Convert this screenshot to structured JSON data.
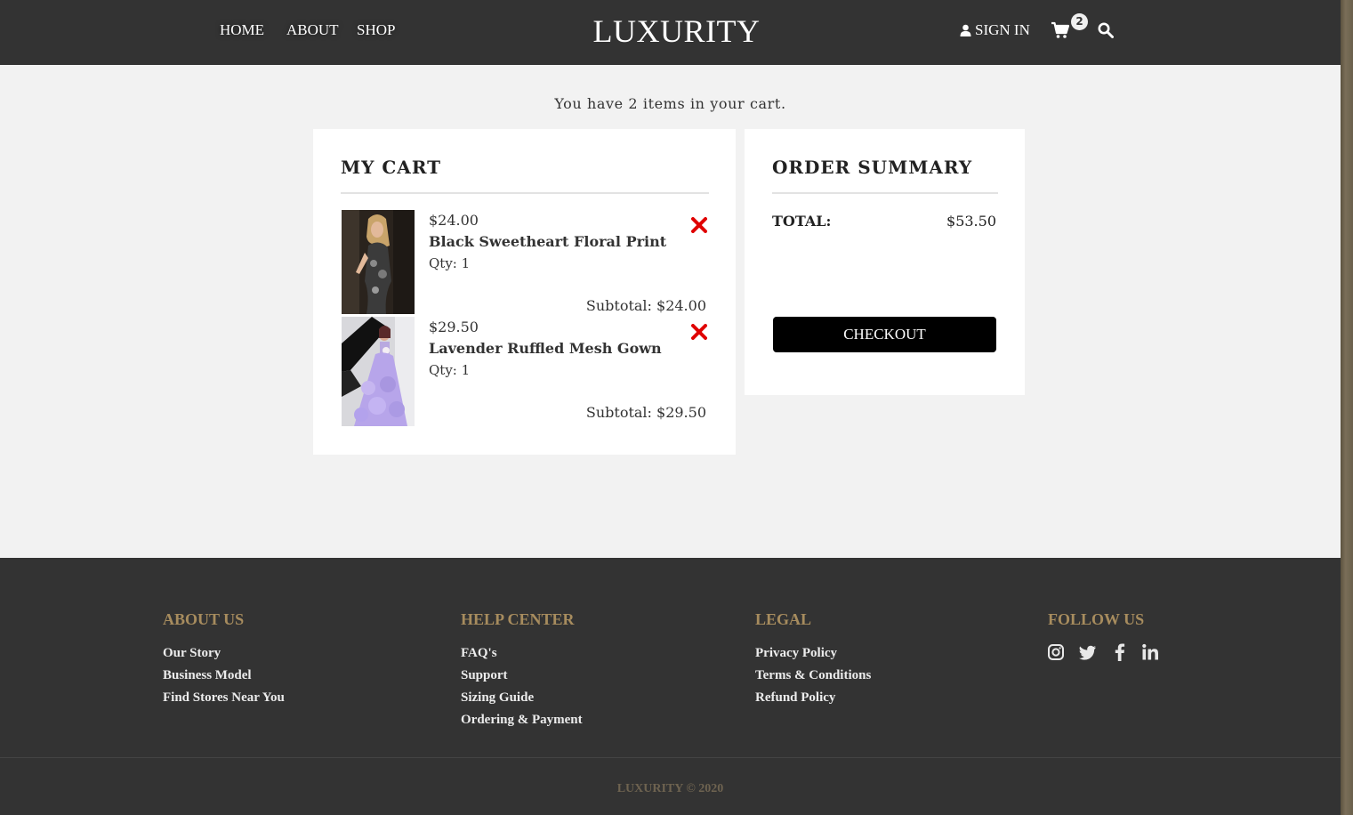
{
  "brand": "LUXURITY",
  "nav": {
    "home": "HOME",
    "about": "ABOUT",
    "shop": "SHOP",
    "sign_in": "SIGN IN",
    "cart_count": "2"
  },
  "cart_message": "You have 2 items in your cart.",
  "cart": {
    "title": "MY CART",
    "items": [
      {
        "price": "$24.00",
        "name": "Black Sweetheart Floral Print",
        "qty": "Qty: 1",
        "subtotal": "Subtotal: $24.00"
      },
      {
        "price": "$29.50",
        "name": "Lavender Ruffled Mesh Gown",
        "qty": "Qty: 1",
        "subtotal": "Subtotal: $29.50"
      }
    ]
  },
  "summary": {
    "title": "ORDER SUMMARY",
    "total_label": "TOTAL:",
    "total_value": "$53.50",
    "checkout_label": "CHECKOUT"
  },
  "footer": {
    "about": {
      "heading": "ABOUT US",
      "links": [
        "Our Story",
        "Business Model",
        "Find Stores Near You"
      ]
    },
    "help": {
      "heading": "HELP CENTER",
      "links": [
        "FAQ's",
        "Support",
        "Sizing Guide",
        "Ordering & Payment"
      ]
    },
    "legal": {
      "heading": "LEGAL",
      "links": [
        "Privacy Policy",
        "Terms & Conditions",
        "Refund Policy"
      ]
    },
    "follow": {
      "heading": "FOLLOW US",
      "icons": [
        "instagram-icon",
        "twitter-icon",
        "facebook-icon",
        "linkedin-icon"
      ]
    },
    "copyright": "LUXURITY © 2020"
  },
  "colors": {
    "header_bg": "#333333",
    "page_bg": "#f2f2f2",
    "footer_heading": "#a78c5e",
    "remove_icon": "#e00000",
    "checkout_bg": "#000000"
  }
}
